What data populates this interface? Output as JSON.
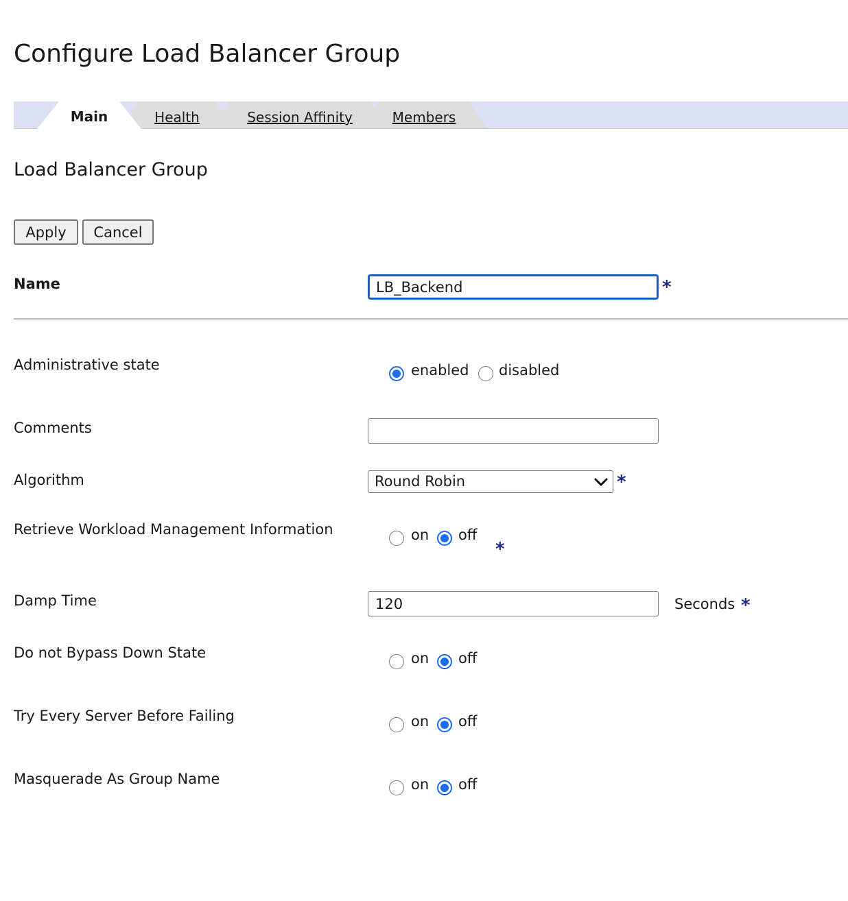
{
  "page": {
    "title": "Configure Load Balancer Group",
    "section_title": "Load Balancer Group"
  },
  "tabs": [
    {
      "label": "Main",
      "active": true
    },
    {
      "label": "Health",
      "active": false
    },
    {
      "label": "Session Affinity",
      "active": false
    },
    {
      "label": "Members",
      "active": false
    }
  ],
  "actions": {
    "apply": "Apply",
    "cancel": "Cancel"
  },
  "required_marker": "*",
  "form": {
    "name": {
      "label": "Name",
      "value": "LB_Backend"
    },
    "admin_state": {
      "label": "Administrative state",
      "options": [
        "enabled",
        "disabled"
      ],
      "selected": "enabled"
    },
    "comments": {
      "label": "Comments",
      "value": ""
    },
    "algorithm": {
      "label": "Algorithm",
      "value": "Round Robin"
    },
    "retrieve_wlm": {
      "label": "Retrieve Workload Management Information",
      "on": "on",
      "off": "off",
      "selected": "off"
    },
    "damp_time": {
      "label": "Damp Time",
      "value": "120",
      "unit": "Seconds"
    },
    "no_bypass_down": {
      "label": "Do not Bypass Down State",
      "on": "on",
      "off": "off",
      "selected": "off"
    },
    "try_every_server": {
      "label": "Try Every Server Before Failing",
      "on": "on",
      "off": "off",
      "selected": "off"
    },
    "masquerade": {
      "label": "Masquerade As Group Name",
      "on": "on",
      "off": "off",
      "selected": "off"
    }
  },
  "colors": {
    "tabbar": "#dde0f5",
    "tab_inactive": "#dddddd",
    "radio_accent": "#1a6cf0",
    "required": "#1f2a8a",
    "focus": "#1f5fbf"
  }
}
